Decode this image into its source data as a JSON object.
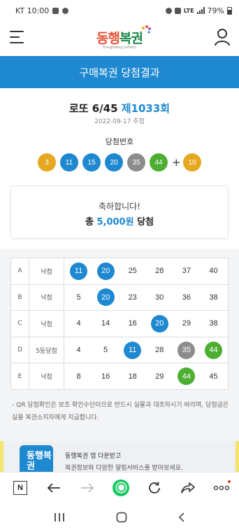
{
  "status_bar": {
    "carrier_time": "KT 10:00",
    "network": "LTE",
    "battery": "79%"
  },
  "header": {
    "logo_part1": "동행",
    "logo_part2": "복권",
    "logo_sub": "Donghaeng Lottery"
  },
  "page_title": "구매복권 당첨결과",
  "draw": {
    "game_name": "로또 6/45",
    "round": "제1033회",
    "date": "2022-09-17 추첨",
    "winning_label": "당첨번호",
    "numbers": [
      {
        "value": "3",
        "color": "#e6a821"
      },
      {
        "value": "11",
        "color": "#1e88d0"
      },
      {
        "value": "15",
        "color": "#1e88d0"
      },
      {
        "value": "20",
        "color": "#1e88d0"
      },
      {
        "value": "35",
        "color": "#8c8c8c"
      },
      {
        "value": "44",
        "color": "#4caf32"
      }
    ],
    "plus": "+",
    "bonus": {
      "value": "10",
      "color": "#e6a821"
    }
  },
  "result_box": {
    "line1": "축하합니다!",
    "line2_prefix": "총",
    "amount": "5,000원",
    "line2_suffix": "당첨"
  },
  "games": [
    {
      "label": "A",
      "result": "낙첨",
      "numbers": [
        {
          "v": "11",
          "hit": true,
          "color": "#1e88d0"
        },
        {
          "v": "20",
          "hit": true,
          "color": "#1e88d0"
        },
        {
          "v": "25"
        },
        {
          "v": "28"
        },
        {
          "v": "37"
        },
        {
          "v": "40"
        }
      ]
    },
    {
      "label": "B",
      "result": "낙첨",
      "numbers": [
        {
          "v": "5"
        },
        {
          "v": "20",
          "hit": true,
          "color": "#1e88d0"
        },
        {
          "v": "23"
        },
        {
          "v": "30"
        },
        {
          "v": "36"
        },
        {
          "v": "38"
        }
      ]
    },
    {
      "label": "C",
      "result": "낙첨",
      "numbers": [
        {
          "v": "4"
        },
        {
          "v": "14"
        },
        {
          "v": "16"
        },
        {
          "v": "20",
          "hit": true,
          "color": "#1e88d0"
        },
        {
          "v": "29"
        },
        {
          "v": "38"
        }
      ]
    },
    {
      "label": "D",
      "result": "5등당첨",
      "numbers": [
        {
          "v": "4"
        },
        {
          "v": "5"
        },
        {
          "v": "11",
          "hit": true,
          "color": "#1e88d0"
        },
        {
          "v": "28"
        },
        {
          "v": "35",
          "hit": true,
          "color": "#8c8c8c"
        },
        {
          "v": "44",
          "hit": true,
          "color": "#4caf32"
        }
      ]
    },
    {
      "label": "E",
      "result": "낙첨",
      "numbers": [
        {
          "v": "8"
        },
        {
          "v": "16"
        },
        {
          "v": "18"
        },
        {
          "v": "29"
        },
        {
          "v": "44",
          "hit": true,
          "color": "#4caf32"
        },
        {
          "v": "45"
        }
      ]
    }
  ],
  "notice": "- QR 당첨확인은 보조 확인수단이므로 반드시 실물과 대조하시기 바라며, 당첨금은 실물 복권소지자에게 지급합니다.",
  "promo": {
    "icon_text": "동행복권",
    "line1": "동행복권 앱 다운받고",
    "line2": "복권정보와 다양한 알림서비스를 받아보세요."
  },
  "browser": {
    "n_label": "N"
  },
  "colors": {
    "primary": "#1e88d0",
    "browser_green": "#17c964"
  }
}
